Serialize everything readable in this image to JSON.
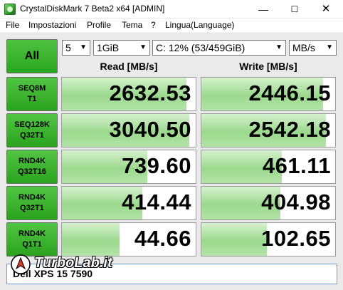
{
  "window": {
    "title": "CrystalDiskMark 7 Beta2 x64 [ADMIN]",
    "minimize_glyph": "—",
    "maximize_glyph": "☐",
    "close_glyph": "✕"
  },
  "menu": {
    "items": [
      "File",
      "Impostazioni",
      "Profile",
      "Tema",
      "?",
      "Lingua(Language)"
    ]
  },
  "controls": {
    "all_label": "All",
    "count": "5",
    "size": "1GiB",
    "drive": "C: 12% (53/459GiB)",
    "unit": "MB/s"
  },
  "headers": {
    "read": "Read [MB/s]",
    "write": "Write [MB/s]"
  },
  "tests": [
    {
      "line1": "SEQ8M",
      "line2": "T1",
      "read": "2632.53",
      "write": "2446.15",
      "read_fill": 0.93,
      "write_fill": 0.91
    },
    {
      "line1": "SEQ128K",
      "line2": "Q32T1",
      "read": "3040.50",
      "write": "2542.18",
      "read_fill": 0.95,
      "write_fill": 0.93
    },
    {
      "line1": "RND4K",
      "line2": "Q32T16",
      "read": "739.60",
      "write": "461.11",
      "read_fill": 0.64,
      "write_fill": 0.6
    },
    {
      "line1": "RND4K",
      "line2": "Q32T1",
      "read": "414.44",
      "write": "404.98",
      "read_fill": 0.6,
      "write_fill": 0.59
    },
    {
      "line1": "RND4K",
      "line2": "Q1T1",
      "read": "44.66",
      "write": "102.65",
      "read_fill": 0.43,
      "write_fill": 0.49
    }
  ],
  "comment": "Dell XPS 15 7590",
  "watermark": {
    "text": "TurboLab.it",
    "icon": "turbolab-rocket-icon"
  },
  "colors": {
    "green": "#2ba31f",
    "fill": "#9bd98d"
  }
}
